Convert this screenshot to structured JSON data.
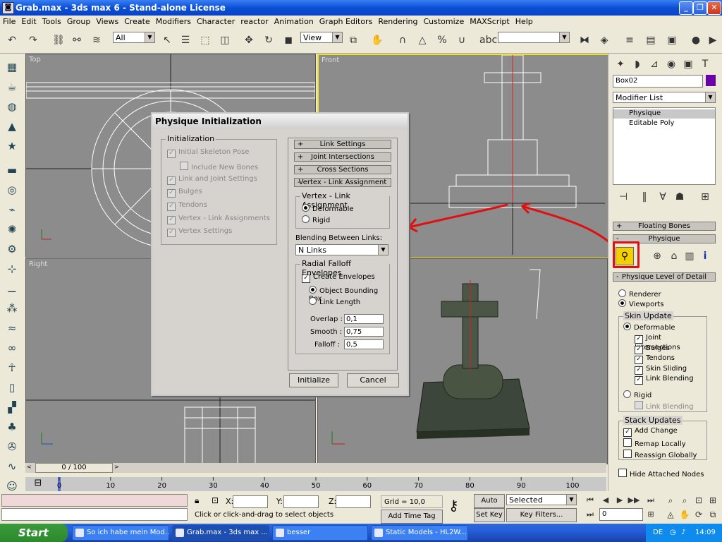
{
  "window": {
    "title": "Grab.max - 3ds max 6 - Stand-alone License"
  },
  "menu": [
    "File",
    "Edit",
    "Tools",
    "Group",
    "Views",
    "Create",
    "Modifiers",
    "Character",
    "reactor",
    "Animation",
    "Graph Editors",
    "Rendering",
    "Customize",
    "MAXScript",
    "Help"
  ],
  "toolbar": {
    "selection_filter": "All",
    "ref_coord": "View",
    "named_sel": ""
  },
  "viewports": {
    "top": "Top",
    "front": "Front",
    "right": "Right"
  },
  "dialog": {
    "title": "Physique Initialization",
    "init_group": "Initialization",
    "init_items": [
      "Initial Skeleton Pose",
      "Include New Bones",
      "Link and Joint Settings",
      "Bulges",
      "Tendons",
      "Vertex - Link Assignments",
      "Vertex Settings"
    ],
    "rollouts": [
      "Link Settings",
      "Joint Intersections",
      "Cross Sections",
      "Vertex - Link Assignment"
    ],
    "plus": "+",
    "minus": "-",
    "vla_group": "Vertex - Link Assignment",
    "deformable": "Deformable",
    "rigid": "Rigid",
    "blending_label": "Blending Between Links:",
    "blending_value": "N Links",
    "rfe_group": "Radial Falloff Envelopes",
    "create_envelopes": "Create Envelopes",
    "object_bbox": "Object Bounding Box",
    "link_length": "Link Length",
    "overlap_label": "Overlap :",
    "overlap_value": "0,1",
    "smooth_label": "Smooth :",
    "smooth_value": "0,75",
    "falloff_label": "Falloff :",
    "falloff_value": "0,5",
    "initialize": "Initialize",
    "cancel": "Cancel"
  },
  "panel": {
    "object_name": "Box02",
    "object_color": "#6a00a8",
    "modifier_list": "Modifier List",
    "stack": [
      "Physique",
      "Editable Poly"
    ],
    "floating_bones": "Floating Bones",
    "physique": "Physique",
    "level_of_detail": "Physique Level of Detail",
    "renderer": "Renderer",
    "viewports": "Viewports",
    "skin_update": "Skin Update",
    "deformable": "Deformable",
    "skin_items": [
      "Joint Intersections",
      "Bulges",
      "Tendons",
      "Skin Sliding",
      "Link Blending"
    ],
    "rigid": "Rigid",
    "rigid_link_blending": "Link Blending",
    "stack_updates": "Stack Updates",
    "add_change": "Add Change",
    "remap_locally": "Remap Locally",
    "reassign_globally": "Reassign Globally",
    "hide_attached": "Hide Attached Nodes"
  },
  "timeline": {
    "frame": "0 / 100",
    "ticks": [
      "0",
      "10",
      "20",
      "30",
      "40",
      "50",
      "60",
      "70",
      "80",
      "90",
      "100"
    ]
  },
  "status": {
    "x_label": "X:",
    "y_label": "Y:",
    "z_label": "Z:",
    "grid": "Grid = 10,0",
    "prompt": "Click or click-and-drag to select objects",
    "add_time_tag": "Add Time Tag",
    "auto_key": "Auto Key",
    "set_key": "Set Key",
    "selected": "Selected",
    "key_filters": "Key Filters...",
    "frame_field": "0"
  },
  "taskbar": {
    "start": "Start",
    "tasks": [
      "So ich habe mein Mod...",
      "Grab.max - 3ds max ...",
      "besser",
      "Static Models - HL2W..."
    ],
    "lang": "DE",
    "time": "14:09"
  },
  "colors": {
    "annotation": "#e01010",
    "viewport_active": "#f0e030"
  }
}
